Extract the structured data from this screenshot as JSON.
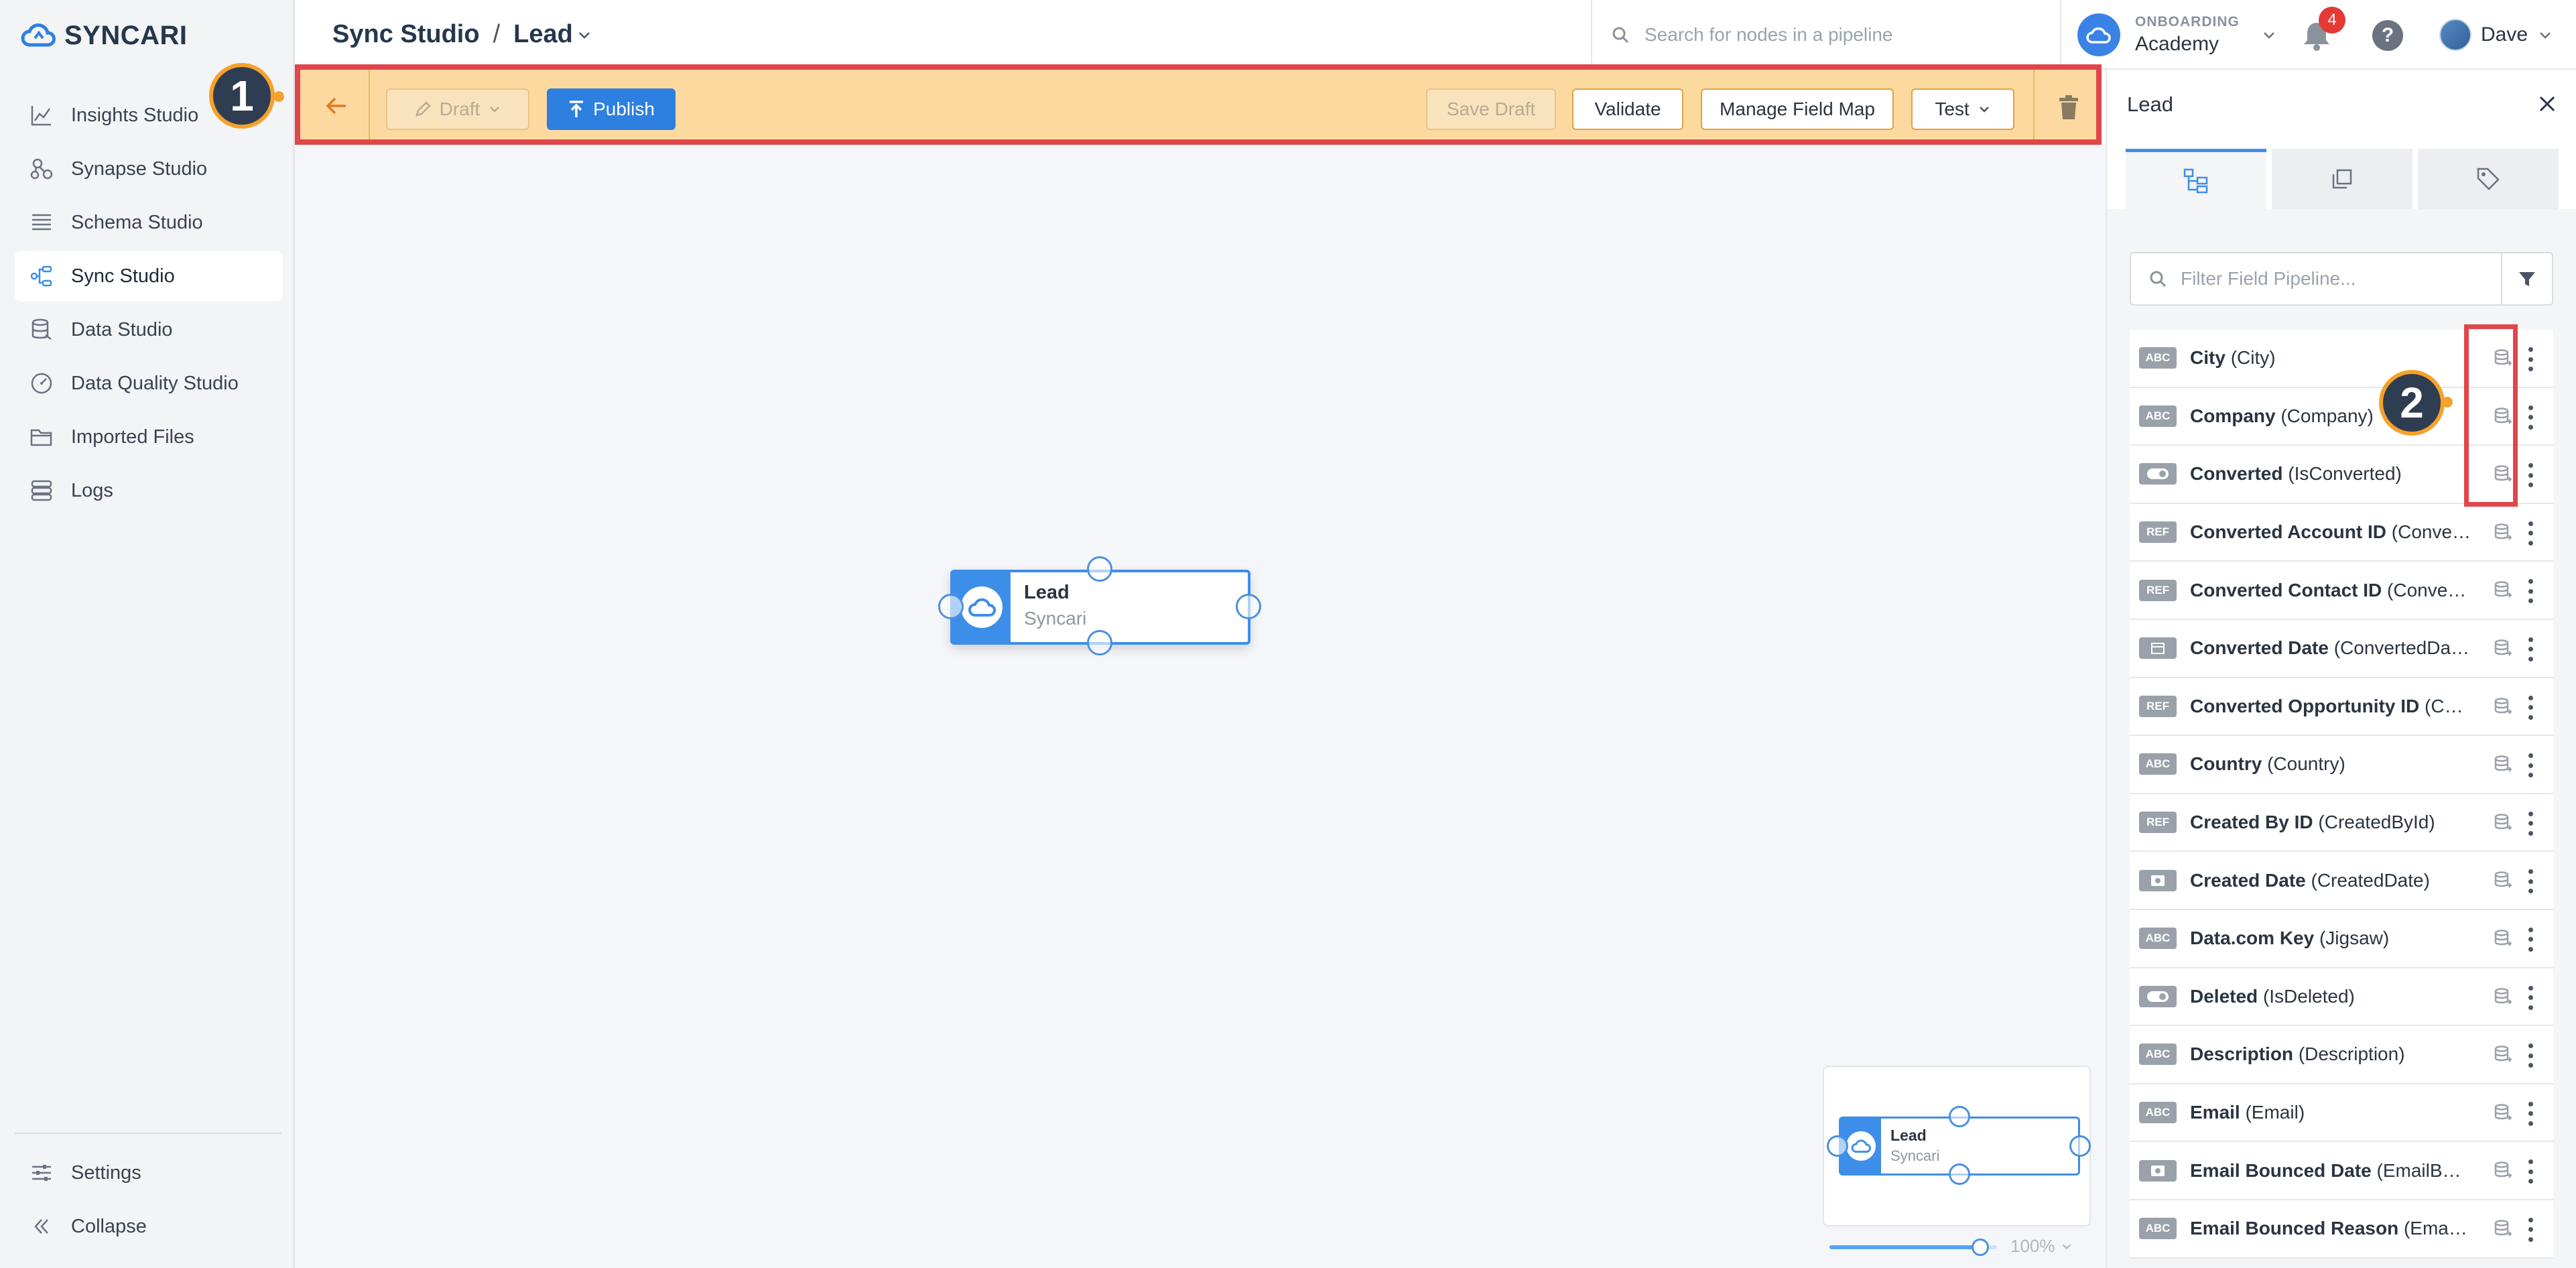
{
  "brand": {
    "name": "SYNCARI"
  },
  "sidebar": {
    "items": [
      {
        "label": "Insights Studio",
        "icon": "chart-icon"
      },
      {
        "label": "Synapse Studio",
        "icon": "synapse-icon"
      },
      {
        "label": "Schema Studio",
        "icon": "schema-icon"
      },
      {
        "label": "Sync Studio",
        "icon": "sync-icon",
        "active": true
      },
      {
        "label": "Data Studio",
        "icon": "database-icon"
      },
      {
        "label": "Data Quality Studio",
        "icon": "gauge-icon"
      },
      {
        "label": "Imported Files",
        "icon": "folder-icon"
      },
      {
        "label": "Logs",
        "icon": "logs-icon"
      }
    ],
    "bottom": [
      {
        "label": "Settings",
        "icon": "sliders-icon"
      },
      {
        "label": "Collapse",
        "icon": "double-chevron-left-icon"
      }
    ]
  },
  "header": {
    "breadcrumb_root": "Sync Studio",
    "breadcrumb_sep": "/",
    "breadcrumb_current": "Lead",
    "search_placeholder": "Search for nodes in a pipeline",
    "org_label": "ONBOARDING",
    "org_name": "Academy",
    "notification_count": "4",
    "help_label": "?",
    "user_name": "Dave"
  },
  "toolbar": {
    "draft_label": "Draft",
    "publish_label": "Publish",
    "save_draft_label": "Save Draft",
    "validate_label": "Validate",
    "manage_field_map_label": "Manage Field Map",
    "test_label": "Test"
  },
  "canvas": {
    "node": {
      "title": "Lead",
      "subtitle": "Syncari"
    },
    "minimap_node": {
      "title": "Lead",
      "subtitle": "Syncari"
    },
    "zoom_label": "100%",
    "zoom_fraction": 0.9
  },
  "panel": {
    "title": "Lead",
    "filter_placeholder": "Filter Field Pipeline...",
    "fields": [
      {
        "type": "ABC",
        "name": "City",
        "api": "(City)"
      },
      {
        "type": "ABC",
        "name": "Company",
        "api": "(Company)"
      },
      {
        "type": "TOGGLE",
        "name": "Converted",
        "api": "(IsConverted)"
      },
      {
        "type": "REF",
        "name": "Converted Account ID",
        "api": "(ConvertedAccountId)"
      },
      {
        "type": "REF",
        "name": "Converted Contact ID",
        "api": "(ConvertedContactId)"
      },
      {
        "type": "DATE",
        "name": "Converted Date",
        "api": "(ConvertedDate)"
      },
      {
        "type": "REF",
        "name": "Converted Opportunity ID",
        "api": "(ConvertedOpportunityId)"
      },
      {
        "type": "ABC",
        "name": "Country",
        "api": "(Country)"
      },
      {
        "type": "REF",
        "name": "Created By ID",
        "api": "(CreatedById)"
      },
      {
        "type": "DATETIME",
        "name": "Created Date",
        "api": "(CreatedDate)"
      },
      {
        "type": "ABC",
        "name": "Data.com Key",
        "api": "(Jigsaw)"
      },
      {
        "type": "TOGGLE",
        "name": "Deleted",
        "api": "(IsDeleted)"
      },
      {
        "type": "ABC",
        "name": "Description",
        "api": "(Description)"
      },
      {
        "type": "ABC",
        "name": "Email",
        "api": "(Email)"
      },
      {
        "type": "DATETIME",
        "name": "Email Bounced Date",
        "api": "(EmailBouncedDate)"
      },
      {
        "type": "ABC",
        "name": "Email Bounced Reason",
        "api": "(EmailBouncedReason)"
      }
    ]
  },
  "callouts": {
    "one": "1",
    "two": "2"
  },
  "colors": {
    "accent": "#3d8ee8",
    "toolbar_bg": "#fcd99f",
    "highlight": "#e0464a",
    "callout": "#2f3d52"
  }
}
